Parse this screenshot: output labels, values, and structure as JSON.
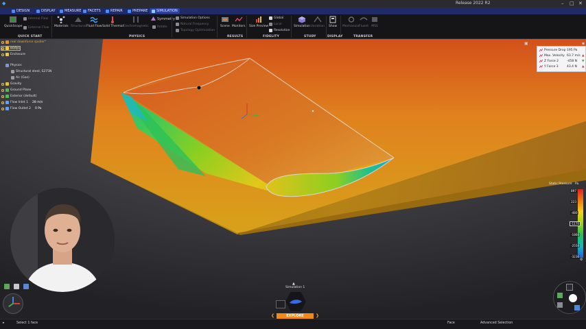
{
  "window": {
    "title": "Release 2022 R2",
    "controls": [
      "–",
      "□",
      "✕"
    ]
  },
  "tabs": [
    {
      "label": "DESIGN",
      "active": false
    },
    {
      "label": "DISPLAY",
      "active": false
    },
    {
      "label": "MEASURE",
      "active": false
    },
    {
      "label": "FACETS",
      "active": false
    },
    {
      "label": "REPAIR",
      "active": false
    },
    {
      "label": "PREPARE",
      "active": false
    },
    {
      "label": "SIMULATION",
      "active": true
    }
  ],
  "ribbon": {
    "quickstart": {
      "label": "QuickScope",
      "items": [
        "Internal Flow",
        "External Flow"
      ],
      "group": "QUICK START"
    },
    "physics": {
      "items": [
        "Materials",
        "Structural",
        "Fluid Flow",
        "Solid Thermal",
        "Electromagnetic"
      ],
      "symmetry": "Symmetry",
      "rotate": "Rotate",
      "group": "PHYSICS"
    },
    "simulation": {
      "items": [
        "Simulation Options",
        "Natural Frequency",
        "Topology Optimization"
      ]
    },
    "results": {
      "items": [
        "Scene",
        "Monitors"
      ],
      "group": "RESULTS"
    },
    "fidelity": {
      "size_preview": "Size Preview",
      "items": [
        "Global",
        "Local",
        "Resolution"
      ],
      "group": "FIDELITY"
    },
    "study": {
      "items": [
        "Simulation",
        "Variation"
      ],
      "group": "STUDY"
    },
    "display": {
      "items": [
        "Show"
      ],
      "group": "DISPLAY"
    },
    "transfer": {
      "items": [
        "Mechanical",
        "Fluent",
        "MSS"
      ],
      "group": "TRANSFER"
    }
  },
  "tree": {
    "root": "real downforce spoiler*",
    "items": [
      {
        "label": "Body1",
        "value": "",
        "selected": true
      },
      {
        "label": "Enclosure",
        "value": ""
      },
      {
        "label": "Physics",
        "value": ""
      },
      {
        "label": "Structural steel, S275N",
        "value": ""
      },
      {
        "label": "Air (Gas)",
        "value": ""
      },
      {
        "label": "Gravity",
        "value": ""
      },
      {
        "label": "Ground Plane",
        "value": ""
      },
      {
        "label": "Exterior (default)",
        "value": ""
      },
      {
        "label": "Flow Inlet 1",
        "value": "28 m/s"
      },
      {
        "label": "Flow Outlet 2",
        "value": "0 Pa"
      }
    ]
  },
  "results_panel": {
    "rows": [
      {
        "label": "Pressure Drop",
        "value": "195 Pa",
        "flag": ""
      },
      {
        "label": "Max. Velocity",
        "value": "63.7 m/s",
        "flag": "▲"
      },
      {
        "label": "Z Force 2",
        "value": "-458 N",
        "flag": "▼"
      },
      {
        "label": "Y Force 3",
        "value": "43.4 N",
        "flag": "▲"
      }
    ]
  },
  "legend": {
    "title": "Static Pressure",
    "unit": "Pa",
    "ticks": [
      "897",
      "223",
      "-480",
      "-1170",
      "-1860",
      "-2550",
      "-3230"
    ],
    "selected_tick": "-1170"
  },
  "simulation_label": "Simulation 1",
  "explore_label": "EXPLORE",
  "status": {
    "left": "Select 1 face",
    "center": "Face",
    "right": "Advanced Selection"
  },
  "colors": {
    "tab_bar": "#1f2a66",
    "accent": "#f08a1a",
    "active_tab": "#2b3fa8"
  }
}
